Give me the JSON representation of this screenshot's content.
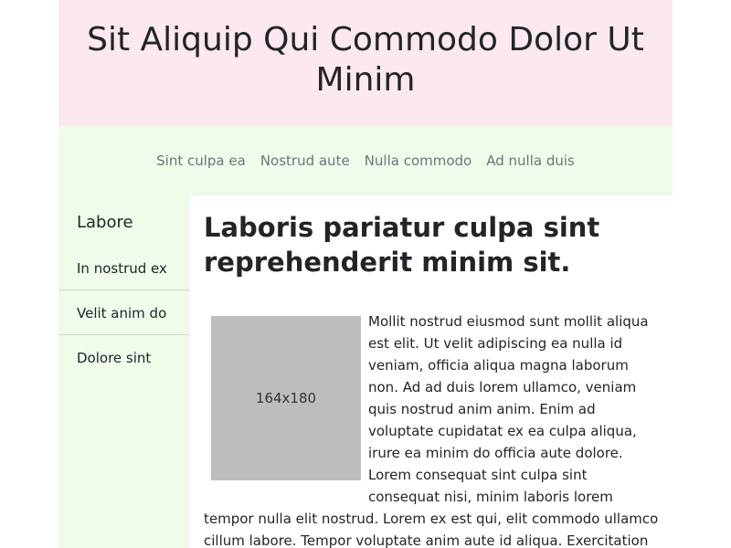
{
  "header": {
    "title": "Sit Aliquip Qui Commodo Dolor Ut Minim"
  },
  "nav": {
    "links": [
      "Sint culpa ea",
      "Nostrud aute",
      "Nulla commodo",
      "Ad nulla duis"
    ]
  },
  "sidebar": {
    "heading": "Labore",
    "items": [
      "In nostrud ex",
      "Velit anim do",
      "Dolore sint"
    ]
  },
  "main": {
    "heading": "Laboris pariatur culpa sint reprehenderit minim sit.",
    "image_label": "164x180",
    "paragraph": "Mollit nostrud eiusmod sunt mollit aliqua est elit. Ut velit adipiscing ea nulla id veniam, officia aliqua magna laborum non. Ad ad duis lorem ullamco, veniam quis nostrud anim anim. Enim ad voluptate cupidatat ex ea culpa aliqua, irure ea minim do officia aute dolore. Lorem consequat sint culpa sint consequat nisi, minim laboris lorem tempor nulla elit nostrud. Lorem ex est qui, elit commodo ullamco cillum labore. Tempor voluptate anim aute id aliqua. Exercitation commodo qui occaecat labore et eiusmod sunt,"
  },
  "colors": {
    "header_bg": "#fce8ef",
    "nav_bg": "#f0fbea",
    "image_placeholder": "#bdbdbd"
  }
}
